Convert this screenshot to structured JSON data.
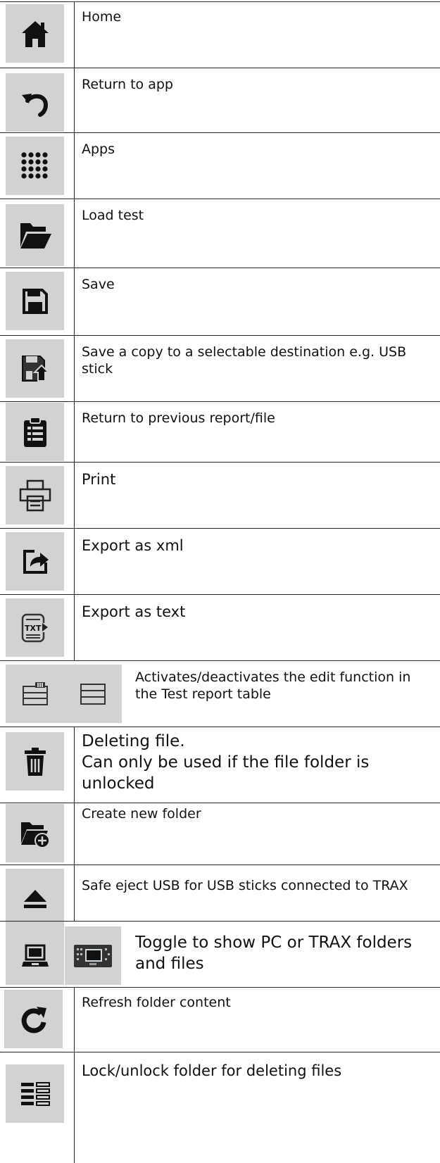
{
  "rows": [
    {
      "icon": "home-icon",
      "text": "Home"
    },
    {
      "icon": "return-icon",
      "text": "Return to app"
    },
    {
      "icon": "apps-grid-icon",
      "text": "Apps"
    },
    {
      "icon": "folder-open-icon",
      "text": "Load test"
    },
    {
      "icon": "save-icon",
      "text": "Save"
    },
    {
      "icon": "save-copy-icon",
      "text": "Save a copy to a selectable destination e.g. USB stick"
    },
    {
      "icon": "clipboard-icon",
      "text": "Return to previous report/file"
    },
    {
      "icon": "printer-icon",
      "text": "Print"
    },
    {
      "icon": "export-xml-icon",
      "text": "Export as xml"
    },
    {
      "icon": "export-text-icon",
      "text": "Export as text"
    },
    {
      "icon": "edit-table-icon",
      "icon2": "table-icon",
      "text": "Activates/deactivates the edit function in the Test report table"
    },
    {
      "icon": "trash-icon",
      "text": "Deleting file.\nCan only be used if the file folder is unlocked"
    },
    {
      "icon": "new-folder-icon",
      "text": "Create new folder"
    },
    {
      "icon": "eject-icon",
      "text": "Safe eject USB for USB sticks connected to TRAX"
    },
    {
      "icon": "laptop-icon",
      "icon2": "trax-device-icon",
      "text": "Toggle to show PC or TRAX folders and files"
    },
    {
      "icon": "refresh-icon",
      "text": "Refresh folder content"
    },
    {
      "icon": "lock-list-icon",
      "text": "Lock/unlock folder for deleting files"
    }
  ]
}
